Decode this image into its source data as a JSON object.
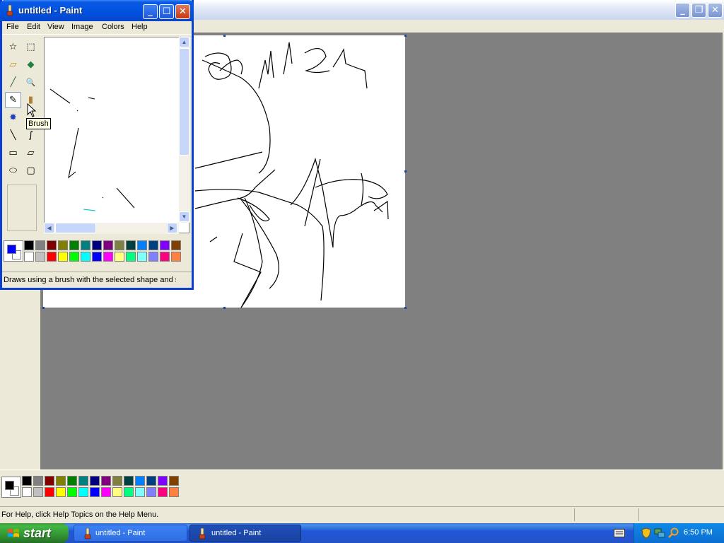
{
  "background_window": {
    "title": "untitled - Paint",
    "status_text": "For Help, click Help Topics on the Help Menu."
  },
  "foreground_window": {
    "title": "untitled - Paint",
    "menu": [
      "File",
      "Edit",
      "View",
      "Image",
      "Colors",
      "Help"
    ],
    "status_text": "Draws using a brush with the selected shape and s",
    "tooltip": "Brush",
    "tools": [
      {
        "name": "free-form-select",
        "glyph": "☆"
      },
      {
        "name": "select",
        "glyph": "⬚"
      },
      {
        "name": "eraser",
        "glyph": "▱"
      },
      {
        "name": "fill-with-color",
        "glyph": "◆"
      },
      {
        "name": "pick-color",
        "glyph": "╱"
      },
      {
        "name": "magnifier",
        "glyph": "🔍"
      },
      {
        "name": "pencil",
        "glyph": "✎"
      },
      {
        "name": "brush",
        "glyph": "▮"
      },
      {
        "name": "airbrush",
        "glyph": "✸"
      },
      {
        "name": "text",
        "glyph": "A"
      },
      {
        "name": "line",
        "glyph": "╲"
      },
      {
        "name": "curve",
        "glyph": "∫"
      },
      {
        "name": "rectangle",
        "glyph": "▭"
      },
      {
        "name": "polygon",
        "glyph": "⏥"
      },
      {
        "name": "ellipse",
        "glyph": "⬭"
      },
      {
        "name": "rounded-rectangle",
        "glyph": "▢"
      }
    ],
    "selected_tool": "pencil",
    "foreground_color": "#0000ff",
    "background_color": "#ffffff"
  },
  "palette": {
    "top": [
      "#000000",
      "#808080",
      "#800000",
      "#808000",
      "#008000",
      "#008080",
      "#000080",
      "#800080",
      "#808040",
      "#004040",
      "#0080ff",
      "#004080",
      "#8000ff",
      "#804000"
    ],
    "bottom": [
      "#ffffff",
      "#c0c0c0",
      "#ff0000",
      "#ffff00",
      "#00ff00",
      "#00ffff",
      "#0000ff",
      "#ff00ff",
      "#ffff80",
      "#00ff80",
      "#80ffff",
      "#8080ff",
      "#ff0080",
      "#ff8040"
    ]
  },
  "background_current_colors": {
    "foreground": "#000000",
    "background": "#ffffff"
  },
  "taskbar": {
    "start_label": "start",
    "tasks": [
      {
        "label": "untitled - Paint",
        "active": false
      },
      {
        "label": "untitled - Paint",
        "active": true
      }
    ],
    "clock": "6:50 PM"
  }
}
